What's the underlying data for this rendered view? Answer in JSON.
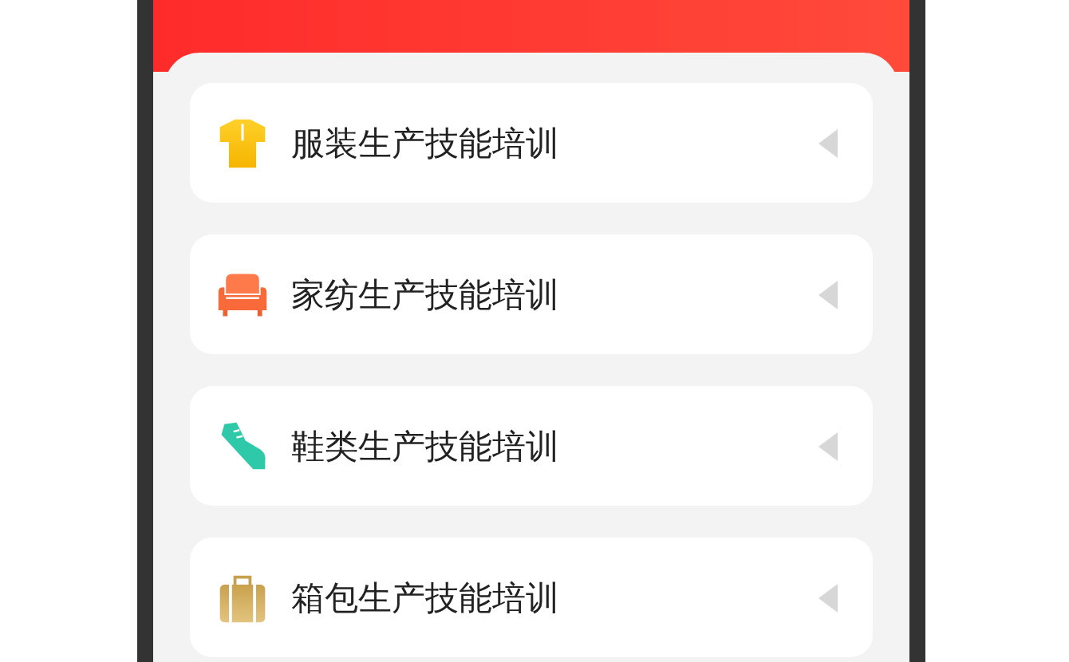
{
  "items": [
    {
      "kind": "shirt",
      "label": "服装生产技能培训"
    },
    {
      "kind": "sofa",
      "label": "家纺生产技能培训"
    },
    {
      "kind": "shoe",
      "label": "鞋类生产技能培训"
    },
    {
      "kind": "bag",
      "label": "箱包生产技能培训"
    }
  ]
}
